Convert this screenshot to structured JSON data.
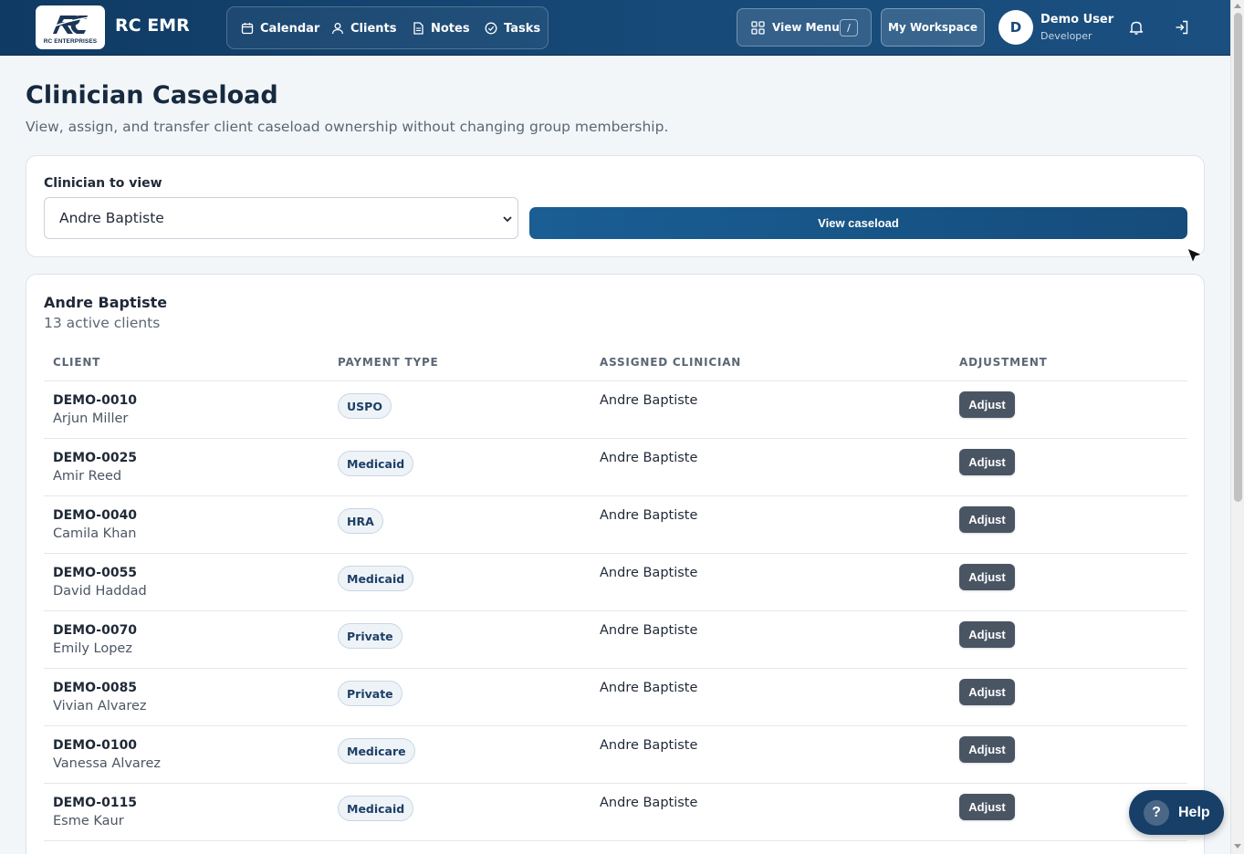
{
  "header": {
    "logo_text": "RC ENTERPRISES",
    "brand": "RC EMR",
    "nav": [
      {
        "label": "Calendar",
        "icon": "calendar-icon"
      },
      {
        "label": "Clients",
        "icon": "user-icon"
      },
      {
        "label": "Notes",
        "icon": "document-icon"
      },
      {
        "label": "Tasks",
        "icon": "check-circle-icon"
      }
    ],
    "view_menu_label": "View Menu",
    "view_menu_shortcut": "/",
    "workspace_label": "My Workspace",
    "user": {
      "initial": "D",
      "name": "Demo User",
      "role": "Developer"
    },
    "colors": {
      "bar": "#174a78",
      "accent": "#1a5e94"
    }
  },
  "page": {
    "title": "Clinician Caseload",
    "subtitle": "View, assign, and transfer client caseload ownership without changing group membership."
  },
  "selector": {
    "label": "Clinician to view",
    "selected": "Andre Baptiste",
    "button_label": "View caseload"
  },
  "caseload": {
    "clinician": "Andre Baptiste",
    "count_text": "13 active clients",
    "columns": [
      "CLIENT",
      "PAYMENT TYPE",
      "ASSIGNED CLINICIAN",
      "ADJUSTMENT"
    ],
    "rows": [
      {
        "id": "DEMO-0010",
        "name": "Arjun Miller",
        "payment": "USPO",
        "clinician": "Andre Baptiste",
        "action": "Adjust"
      },
      {
        "id": "DEMO-0025",
        "name": "Amir Reed",
        "payment": "Medicaid",
        "clinician": "Andre Baptiste",
        "action": "Adjust"
      },
      {
        "id": "DEMO-0040",
        "name": "Camila Khan",
        "payment": "HRA",
        "clinician": "Andre Baptiste",
        "action": "Adjust"
      },
      {
        "id": "DEMO-0055",
        "name": "David Haddad",
        "payment": "Medicaid",
        "clinician": "Andre Baptiste",
        "action": "Adjust"
      },
      {
        "id": "DEMO-0070",
        "name": "Emily Lopez",
        "payment": "Private",
        "clinician": "Andre Baptiste",
        "action": "Adjust"
      },
      {
        "id": "DEMO-0085",
        "name": "Vivian Alvarez",
        "payment": "Private",
        "clinician": "Andre Baptiste",
        "action": "Adjust"
      },
      {
        "id": "DEMO-0100",
        "name": "Vanessa Alvarez",
        "payment": "Medicare",
        "clinician": "Andre Baptiste",
        "action": "Adjust"
      },
      {
        "id": "DEMO-0115",
        "name": "Esme Kaur",
        "payment": "Medicaid",
        "clinician": "Andre Baptiste",
        "action": "Adjust"
      }
    ]
  },
  "help": {
    "icon": "?",
    "label": "Help"
  }
}
